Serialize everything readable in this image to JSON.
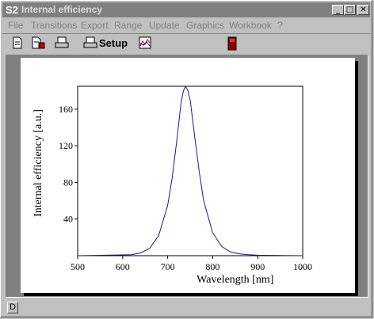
{
  "window": {
    "title": "Internal efficiency",
    "app_icon": "S2",
    "controls": {
      "minimize": "_",
      "maximize": "□",
      "close": "✕"
    }
  },
  "menu": [
    {
      "label": "File"
    },
    {
      "label": "Transitions"
    },
    {
      "label": "Export"
    },
    {
      "label": "Range"
    },
    {
      "label": "Update"
    },
    {
      "label": "Graphics"
    },
    {
      "label": "Workbook"
    },
    {
      "label": "?"
    }
  ],
  "toolbar": {
    "setup_label": "Setup",
    "icons": [
      "page-icon",
      "save-page-icon",
      "print-icon",
      "print-setup-icon",
      "graph-icon",
      "exit-icon"
    ]
  },
  "status": {
    "cell": "D"
  },
  "colors": {
    "curve": "#1a1a8c",
    "titlebar": "#808080"
  },
  "chart_data": {
    "type": "line",
    "xlabel": "Wavelength [nm]",
    "ylabel": "Internal efficiency [a.u.]",
    "xlim": [
      500,
      1000
    ],
    "ylim": [
      0,
      185
    ],
    "xticks": [
      500,
      600,
      700,
      800,
      900,
      1000
    ],
    "yticks": [
      40,
      80,
      120,
      160
    ],
    "grid": false,
    "series": [
      {
        "x": [
          500,
          620,
          640,
          660,
          680,
          700,
          710,
          720,
          730,
          735,
          740,
          745,
          750,
          760,
          770,
          780,
          800,
          820,
          840,
          860,
          880,
          900,
          1000
        ],
        "y": [
          0,
          1,
          3,
          8,
          22,
          55,
          85,
          125,
          168,
          180,
          185,
          180,
          170,
          130,
          92,
          60,
          25,
          10,
          4,
          2,
          1,
          0.5,
          0
        ]
      }
    ]
  }
}
